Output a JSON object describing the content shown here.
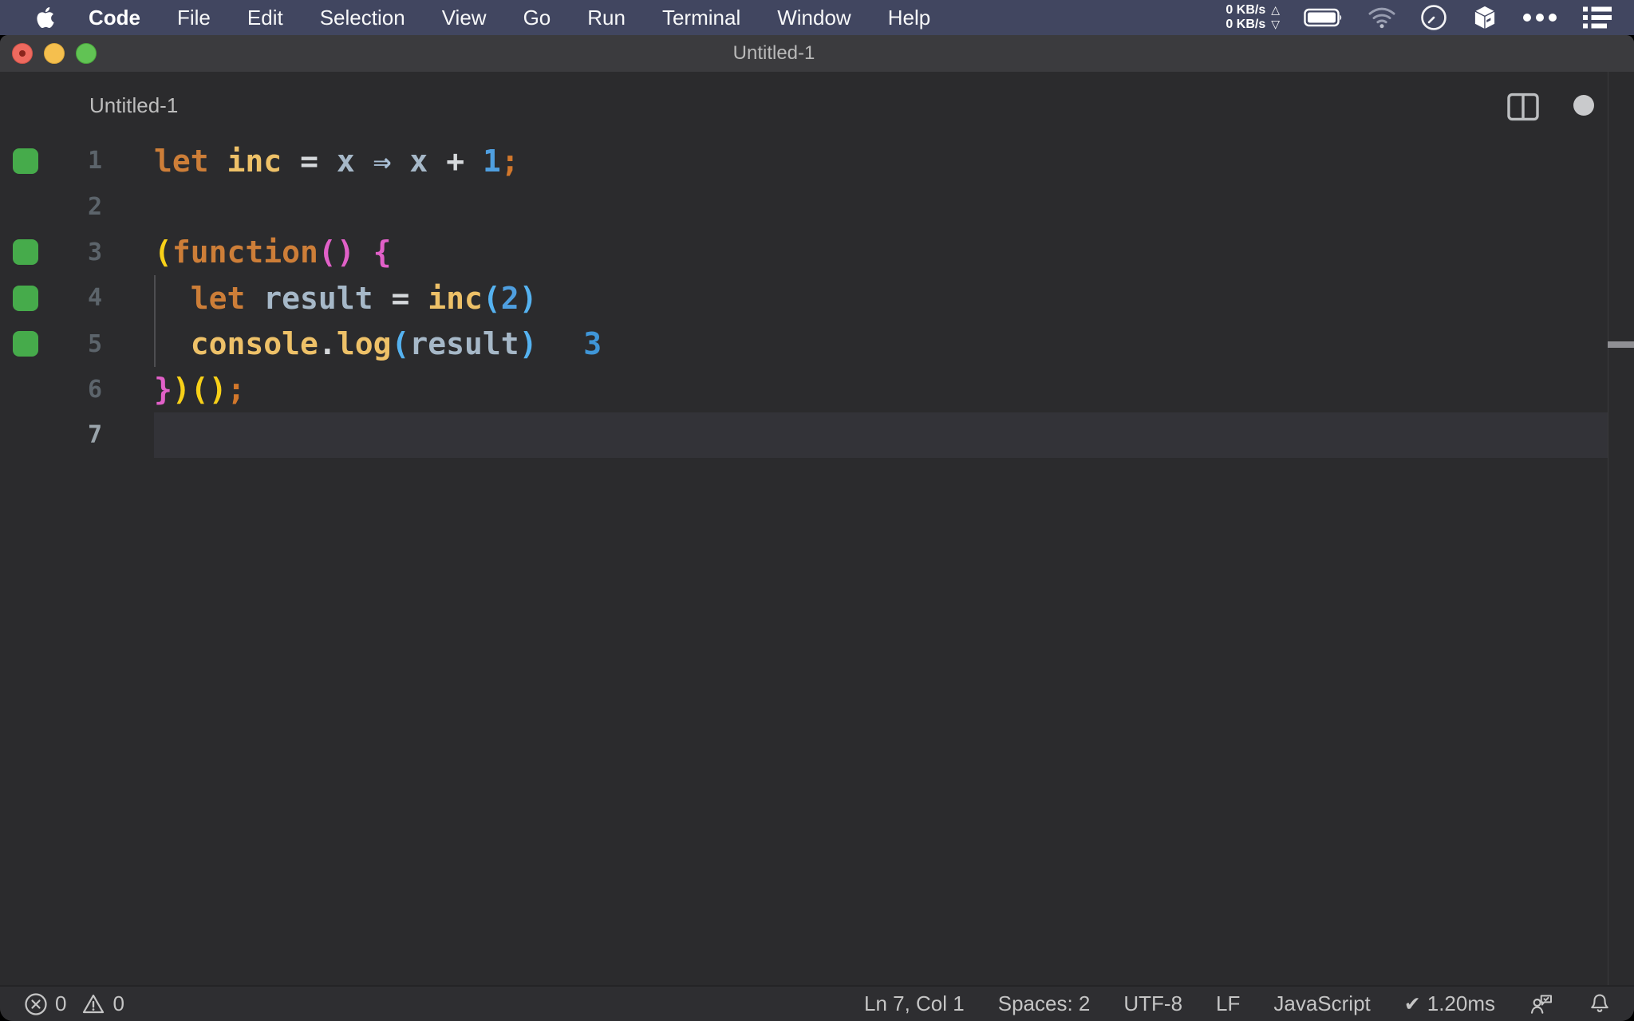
{
  "menu_bar": {
    "app_menu": "Code",
    "items": [
      "File",
      "Edit",
      "Selection",
      "View",
      "Go",
      "Run",
      "Terminal",
      "Window",
      "Help"
    ],
    "net_up": "0 KB/s",
    "net_down": "0 KB/s",
    "up_arrow": "△",
    "down_arrow": "▽"
  },
  "window": {
    "title": "Untitled-1"
  },
  "editor": {
    "tab_label": "Untitled-1",
    "colors": {
      "keyword": "#cd7e38",
      "identifier": "#eec168",
      "variable": "#a6b8c8",
      "operator": "#d6d9dc",
      "arrow": "#a9bfd6",
      "number": "#4f9fe0",
      "semicolon": "#d2772b",
      "bracket1": "#f7d018",
      "bracket2": "#e160c8",
      "bracket3": "#55b2f0",
      "inline_value": "#3f96d8",
      "plain": "#c8ccd0",
      "coverage_green": "#46ab4b",
      "line_number": "#5c646b",
      "line_number_active": "#9aa4ab",
      "current_line_bg": "#333338"
    },
    "lines": [
      {
        "num": "1",
        "covered": true,
        "active": false,
        "tokens": [
          {
            "t": "let",
            "c": "kw"
          },
          {
            "t": " ",
            "c": "pl"
          },
          {
            "t": "inc",
            "c": "id"
          },
          {
            "t": " ",
            "c": "pl"
          },
          {
            "t": "=",
            "c": "op"
          },
          {
            "t": " ",
            "c": "pl"
          },
          {
            "t": "x",
            "c": "vr"
          },
          {
            "t": " ",
            "c": "pl"
          },
          {
            "t": "⇒",
            "c": "ar"
          },
          {
            "t": " ",
            "c": "pl"
          },
          {
            "t": "x",
            "c": "vr"
          },
          {
            "t": " ",
            "c": "pl"
          },
          {
            "t": "+",
            "c": "op"
          },
          {
            "t": " ",
            "c": "pl"
          },
          {
            "t": "1",
            "c": "nu"
          },
          {
            "t": ";",
            "c": "se"
          }
        ]
      },
      {
        "num": "2",
        "covered": false,
        "active": false,
        "tokens": []
      },
      {
        "num": "3",
        "covered": true,
        "active": false,
        "tokens": [
          {
            "t": "(",
            "c": "b1"
          },
          {
            "t": "function",
            "c": "kw"
          },
          {
            "t": "(",
            "c": "b2"
          },
          {
            "t": ")",
            "c": "b2"
          },
          {
            "t": " ",
            "c": "pl"
          },
          {
            "t": "{",
            "c": "b2"
          }
        ]
      },
      {
        "num": "4",
        "covered": true,
        "active": false,
        "tokens": [
          {
            "t": "  ",
            "c": "pl"
          },
          {
            "t": "let",
            "c": "kw"
          },
          {
            "t": " ",
            "c": "pl"
          },
          {
            "t": "result",
            "c": "vr"
          },
          {
            "t": " ",
            "c": "pl"
          },
          {
            "t": "=",
            "c": "op"
          },
          {
            "t": " ",
            "c": "pl"
          },
          {
            "t": "inc",
            "c": "id"
          },
          {
            "t": "(",
            "c": "b3"
          },
          {
            "t": "2",
            "c": "nu"
          },
          {
            "t": ")",
            "c": "b3"
          }
        ]
      },
      {
        "num": "5",
        "covered": true,
        "active": false,
        "tokens": [
          {
            "t": "  ",
            "c": "pl"
          },
          {
            "t": "console",
            "c": "id"
          },
          {
            "t": ".",
            "c": "op"
          },
          {
            "t": "log",
            "c": "id"
          },
          {
            "t": "(",
            "c": "b3"
          },
          {
            "t": "result",
            "c": "vr"
          },
          {
            "t": ")",
            "c": "b3"
          },
          {
            "t": "  ",
            "c": "pl"
          },
          {
            "t": "3",
            "c": "val"
          }
        ]
      },
      {
        "num": "6",
        "covered": false,
        "active": false,
        "tokens": [
          {
            "t": "}",
            "c": "b2"
          },
          {
            "t": ")",
            "c": "b1"
          },
          {
            "t": "(",
            "c": "b1"
          },
          {
            "t": ")",
            "c": "b1"
          },
          {
            "t": ";",
            "c": "se"
          }
        ]
      },
      {
        "num": "7",
        "covered": false,
        "active": true,
        "tokens": []
      }
    ]
  },
  "status_bar": {
    "errors": "0",
    "warnings": "0",
    "cursor_position": "Ln 7, Col 1",
    "indentation": "Spaces: 2",
    "encoding": "UTF-8",
    "eol": "LF",
    "language": "JavaScript",
    "check": "✔",
    "perf": "1.20ms"
  }
}
